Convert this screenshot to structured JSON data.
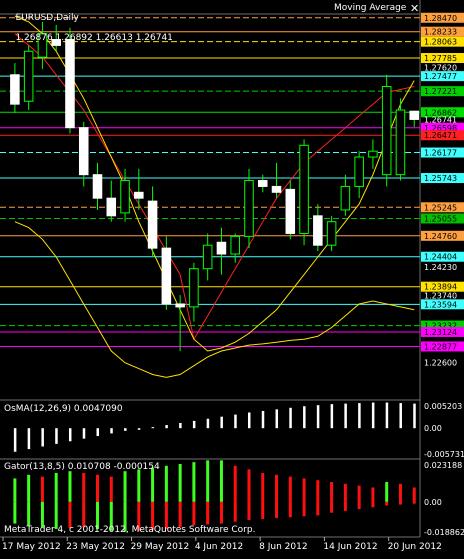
{
  "header": {
    "symbol_tf": "EURUSD,Daily",
    "ohlc": "1.26876 1.26892 1.26613 1.26741",
    "indicator_name": "Moving Average",
    "close_glyph": "✕",
    "close_icon": "close-icon"
  },
  "copyright": "MetaTrader 4, c 2001-2012, MetaQuotes Software Corp.",
  "chart_data": [
    {
      "type": "candlestick",
      "title": "EURUSD,Daily",
      "ylim": [
        1.22,
        1.285
      ],
      "price_ticks": [
        "1.28470",
        "1.28233",
        "1.28063",
        "1.27785",
        "1.27620",
        "1.27477",
        "1.27221",
        "1.26862",
        "1.26741",
        "1.26598",
        "1.26471",
        "1.26177",
        "1.25743",
        "1.25245",
        "1.25055",
        "1.24760",
        "1.24404",
        "1.24230",
        "1.23894",
        "1.23740",
        "1.23594",
        "1.23232",
        "1.23124",
        "1.22877",
        "1.22600"
      ],
      "price_lines": [
        {
          "label": "1.28470",
          "color": "#ffa040",
          "style": "dash"
        },
        {
          "label": "1.28233",
          "color": "#ffa040",
          "style": "solid"
        },
        {
          "label": "1.28063",
          "color": "#ffe200",
          "style": "dash"
        },
        {
          "label": "1.27785",
          "color": "#ffe200",
          "style": "solid"
        },
        {
          "label": "1.27477",
          "color": "#40ffff",
          "style": "solid"
        },
        {
          "label": "1.27221",
          "color": "#00d000",
          "style": "dash"
        },
        {
          "label": "1.26862",
          "color": "#00e000",
          "style": "solid"
        },
        {
          "label": "1.26598",
          "color": "#ff00ff",
          "style": "solid"
        },
        {
          "label": "1.26471",
          "color": "#ff2020",
          "style": "solid"
        },
        {
          "label": "1.26177",
          "color": "#40ffff",
          "style": "dash"
        },
        {
          "label": "1.25743",
          "color": "#40ffff",
          "style": "solid"
        },
        {
          "label": "1.25245",
          "color": "#ffa040",
          "style": "dash"
        },
        {
          "label": "1.25055",
          "color": "#00c000",
          "style": "dash"
        },
        {
          "label": "1.24760",
          "color": "#ffa040",
          "style": "solid"
        },
        {
          "label": "1.24404",
          "color": "#40ffff",
          "style": "solid"
        },
        {
          "label": "1.23894",
          "color": "#ffe200",
          "style": "solid"
        },
        {
          "label": "1.23594",
          "color": "#40ffff",
          "style": "solid"
        },
        {
          "label": "1.23232",
          "color": "#00d000",
          "style": "dash"
        },
        {
          "label": "1.23124",
          "color": "#ff00ff",
          "style": "solid"
        },
        {
          "label": "1.22877",
          "color": "#ff00ff",
          "style": "solid"
        }
      ],
      "x_labels": [
        "17 May 2012",
        "23 May 2012",
        "29 May 2012",
        "4 Jun 2012",
        "8 Jun 2012",
        "14 Jun 2012",
        "20 Jun 2012"
      ],
      "candles": [
        {
          "o": 1.275,
          "h": 1.277,
          "l": 1.2685,
          "c": 1.27
        },
        {
          "o": 1.2705,
          "h": 1.28,
          "l": 1.269,
          "c": 1.279
        },
        {
          "o": 1.278,
          "h": 1.284,
          "l": 1.276,
          "c": 1.282
        },
        {
          "o": 1.281,
          "h": 1.2835,
          "l": 1.279,
          "c": 1.28
        },
        {
          "o": 1.281,
          "h": 1.283,
          "l": 1.265,
          "c": 1.266
        },
        {
          "o": 1.266,
          "h": 1.267,
          "l": 1.256,
          "c": 1.258
        },
        {
          "o": 1.258,
          "h": 1.26,
          "l": 1.252,
          "c": 1.254
        },
        {
          "o": 1.254,
          "h": 1.257,
          "l": 1.25,
          "c": 1.251
        },
        {
          "o": 1.2515,
          "h": 1.259,
          "l": 1.25,
          "c": 1.257
        },
        {
          "o": 1.255,
          "h": 1.259,
          "l": 1.252,
          "c": 1.254
        },
        {
          "o": 1.2535,
          "h": 1.256,
          "l": 1.244,
          "c": 1.2455
        },
        {
          "o": 1.2455,
          "h": 1.2475,
          "l": 1.235,
          "c": 1.236
        },
        {
          "o": 1.236,
          "h": 1.2375,
          "l": 1.228,
          "c": 1.2355
        },
        {
          "o": 1.2355,
          "h": 1.243,
          "l": 1.233,
          "c": 1.242
        },
        {
          "o": 1.242,
          "h": 1.248,
          "l": 1.24,
          "c": 1.246
        },
        {
          "o": 1.2465,
          "h": 1.249,
          "l": 1.241,
          "c": 1.2445
        },
        {
          "o": 1.2445,
          "h": 1.248,
          "l": 1.243,
          "c": 1.2475
        },
        {
          "o": 1.2475,
          "h": 1.259,
          "l": 1.2455,
          "c": 1.257
        },
        {
          "o": 1.257,
          "h": 1.258,
          "l": 1.255,
          "c": 1.256
        },
        {
          "o": 1.256,
          "h": 1.26,
          "l": 1.254,
          "c": 1.255
        },
        {
          "o": 1.2555,
          "h": 1.257,
          "l": 1.247,
          "c": 1.248
        },
        {
          "o": 1.248,
          "h": 1.264,
          "l": 1.246,
          "c": 1.263
        },
        {
          "o": 1.251,
          "h": 1.253,
          "l": 1.245,
          "c": 1.246
        },
        {
          "o": 1.246,
          "h": 1.251,
          "l": 1.245,
          "c": 1.25
        },
        {
          "o": 1.252,
          "h": 1.258,
          "l": 1.251,
          "c": 1.256
        },
        {
          "o": 1.256,
          "h": 1.262,
          "l": 1.254,
          "c": 1.261
        },
        {
          "o": 1.261,
          "h": 1.264,
          "l": 1.259,
          "c": 1.262
        },
        {
          "o": 1.258,
          "h": 1.275,
          "l": 1.256,
          "c": 1.273
        },
        {
          "o": 1.258,
          "h": 1.271,
          "l": 1.257,
          "c": 1.269
        },
        {
          "o": 1.2688,
          "h": 1.2689,
          "l": 1.2661,
          "c": 1.2674
        }
      ],
      "ma_lines": [
        {
          "color": "#ff2020",
          "values": [
            1.282,
            1.28,
            1.278,
            1.275,
            1.272,
            1.269,
            1.265,
            1.261,
            1.257,
            1.253,
            1.249,
            1.245,
            1.241,
            1.23,
            1.234,
            1.238,
            1.242,
            1.246,
            1.25,
            1.254,
            1.257,
            1.26,
            1.262,
            1.264,
            1.266,
            1.268,
            1.27,
            1.272,
            1.2725,
            1.273
          ]
        },
        {
          "color": "#ffe200",
          "values": [
            1.285,
            1.284,
            1.282,
            1.279,
            1.275,
            1.271,
            1.266,
            1.261,
            1.256,
            1.25,
            1.245,
            1.24,
            1.235,
            1.23,
            1.228,
            1.2285,
            1.2295,
            1.231,
            1.233,
            1.235,
            1.238,
            1.241,
            1.244,
            1.247,
            1.25,
            1.253,
            1.258,
            1.264,
            1.27,
            1.274
          ]
        },
        {
          "color": "#ffe200",
          "values": [
            1.25,
            1.249,
            1.247,
            1.244,
            1.24,
            1.236,
            1.232,
            1.228,
            1.226,
            1.225,
            1.224,
            1.2235,
            1.224,
            1.2255,
            1.227,
            1.228,
            1.2285,
            1.229,
            1.2292,
            1.2295,
            1.2298,
            1.23,
            1.2305,
            1.232,
            1.234,
            1.236,
            1.2365,
            1.236,
            1.2355,
            1.235
          ]
        }
      ]
    },
    {
      "type": "histogram",
      "title": "OsMA(12,26,9) 0.0047090",
      "ylim": [
        -0.0057,
        0.0052
      ],
      "tick_labels": [
        "0.005203",
        "0.00",
        "-0.005731"
      ],
      "bar_color": "#ffffff",
      "values": [
        -0.0045,
        -0.004,
        -0.0035,
        -0.003,
        -0.0025,
        -0.002,
        -0.0015,
        -0.001,
        -0.0005,
        -0.0003,
        0.0002,
        0.0006,
        0.001,
        0.0014,
        0.0018,
        0.0022,
        0.0026,
        0.003,
        0.0033,
        0.0036,
        0.0039,
        0.0042,
        0.0044,
        0.0046,
        0.0047,
        0.0048,
        0.0049,
        0.0049,
        0.0048,
        0.0047
      ]
    },
    {
      "type": "histogram",
      "title": "Gator(13,8,5) 0.010708 -0.000154",
      "ylim": [
        -0.0189,
        0.0232
      ],
      "tick_labels": [
        "0.023188",
        "0.00",
        "-0.018862"
      ],
      "colors": {
        "up": "#40ff20",
        "down": "#ff1010"
      },
      "upper": [
        0.013,
        0.015,
        0.014,
        0.016,
        0.017,
        0.016,
        0.015,
        0.014,
        0.017,
        0.018,
        0.019,
        0.02,
        0.021,
        0.022,
        0.023,
        0.023,
        0.02,
        0.018,
        0.016,
        0.015,
        0.014,
        0.013,
        0.012,
        0.011,
        0.01,
        0.009,
        0.008,
        0.011,
        0.01,
        0.008
      ],
      "upper_dir": [
        "up",
        "up",
        "down",
        "up",
        "up",
        "down",
        "down",
        "down",
        "up",
        "up",
        "up",
        "up",
        "up",
        "up",
        "up",
        "up",
        "down",
        "down",
        "down",
        "down",
        "down",
        "down",
        "down",
        "down",
        "down",
        "down",
        "down",
        "up",
        "down",
        "down"
      ],
      "lower": [
        -0.012,
        -0.013,
        -0.014,
        -0.015,
        -0.0145,
        -0.014,
        -0.015,
        -0.016,
        -0.0165,
        -0.016,
        -0.0155,
        -0.015,
        -0.014,
        -0.013,
        -0.0125,
        -0.012,
        -0.011,
        -0.01,
        -0.0095,
        -0.009,
        -0.0085,
        -0.008,
        -0.0075,
        -0.006,
        -0.005,
        -0.004,
        -0.003,
        -0.002,
        -0.0015,
        -0.001
      ],
      "lower_dir": [
        "up",
        "up",
        "up",
        "up",
        "down",
        "down",
        "up",
        "up",
        "up",
        "down",
        "down",
        "down",
        "down",
        "down",
        "down",
        "down",
        "down",
        "down",
        "down",
        "down",
        "down",
        "down",
        "down",
        "down",
        "down",
        "down",
        "down",
        "down",
        "down",
        "down"
      ]
    }
  ]
}
